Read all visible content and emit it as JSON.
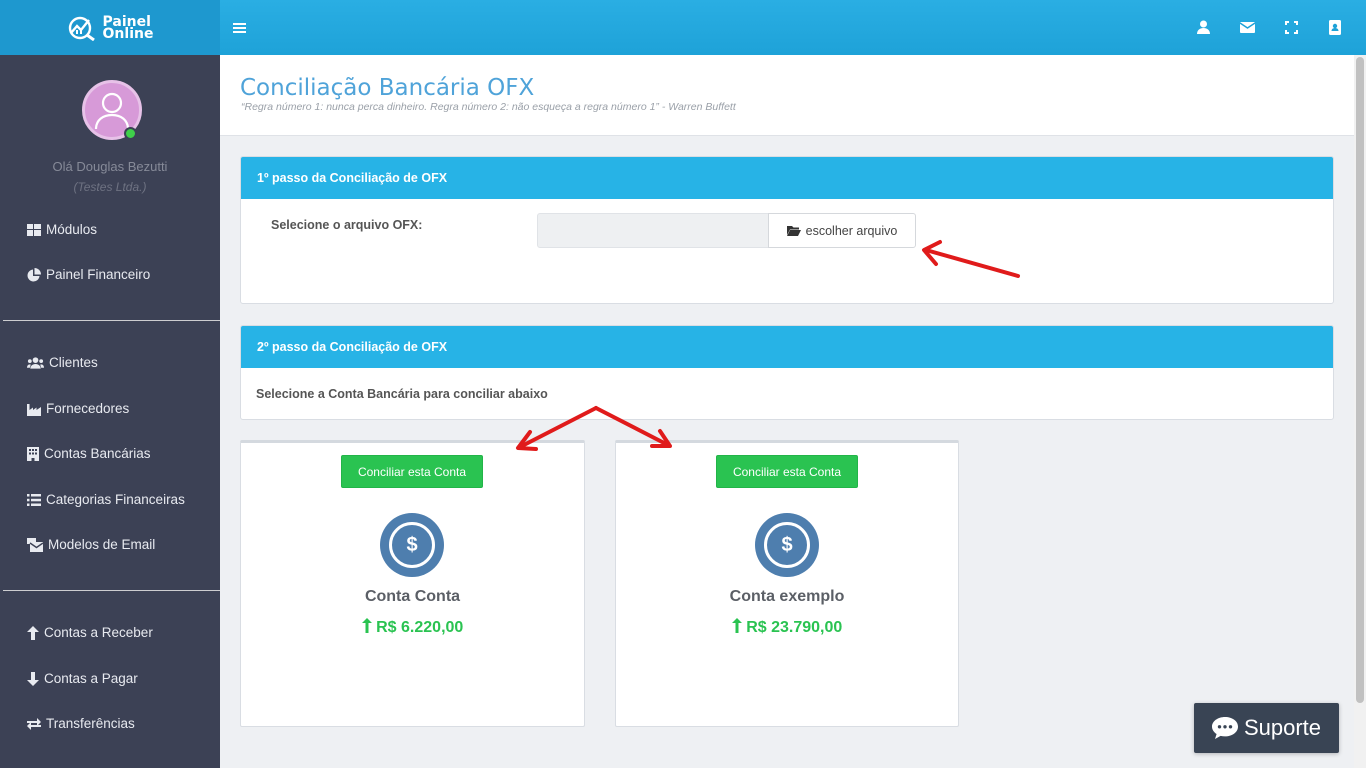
{
  "app": {
    "logo_line1": "Painel",
    "logo_line2": "Online"
  },
  "topbar": {
    "icons": [
      "menu-icon",
      "user-icon",
      "mail-icon",
      "fullscreen-icon",
      "contacts-icon"
    ]
  },
  "sidebar": {
    "greeting": "Olá Douglas Bezutti",
    "company": "(Testes Ltda.)",
    "group1": [
      {
        "label": "Módulos",
        "icon": "grid-icon"
      },
      {
        "label": "Painel Financeiro",
        "icon": "pie-chart-icon"
      }
    ],
    "group2": [
      {
        "label": "Clientes",
        "icon": "users-icon"
      },
      {
        "label": "Fornecedores",
        "icon": "industry-icon"
      },
      {
        "label": "Contas Bancárias",
        "icon": "building-icon"
      },
      {
        "label": "Categorias Financeiras",
        "icon": "list-icon"
      },
      {
        "label": "Modelos de Email",
        "icon": "mail-bulk-icon"
      }
    ],
    "group3": [
      {
        "label": "Contas a Receber",
        "icon": "arrow-up-icon"
      },
      {
        "label": "Contas a Pagar",
        "icon": "arrow-down-icon"
      },
      {
        "label": "Transferências",
        "icon": "exchange-icon"
      }
    ]
  },
  "page": {
    "title": "Conciliação Bancária OFX",
    "quote": "“Regra número 1: nunca perca dinheiro. Regra número 2: não esqueça a regra número 1” - Warren Buffett"
  },
  "step1": {
    "title": "1º passo da Conciliação de OFX",
    "label": "Selecione o arquivo OFX:",
    "file_value": "",
    "button": "escolher arquivo"
  },
  "step2": {
    "title": "2º passo da Conciliação de OFX",
    "text": "Selecione a Conta Bancária para conciliar abaixo"
  },
  "accounts": [
    {
      "button": "Conciliar esta Conta",
      "coin": "$",
      "name": "Conta Conta",
      "balance": "R$ 6.220,00"
    },
    {
      "button": "Conciliar esta Conta",
      "coin": "$",
      "name": "Conta exemplo",
      "balance": "R$ 23.790,00"
    }
  ],
  "support": {
    "label": "Suporte"
  },
  "colors": {
    "topbar": "#27b3e6",
    "sidebar": "#3c4155",
    "success": "#2ac351",
    "title": "#4fa3d9",
    "annotation": "#e01b1b"
  }
}
